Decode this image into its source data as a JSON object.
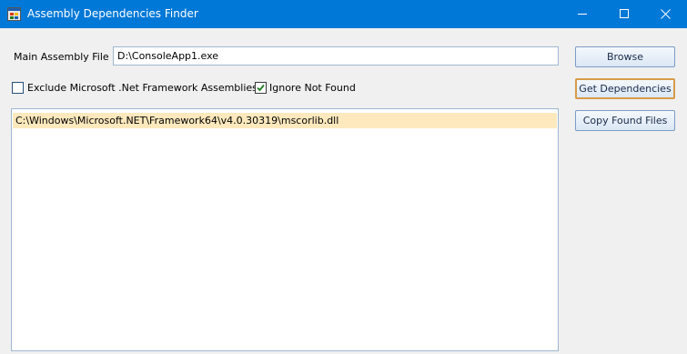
{
  "window": {
    "title": "Assembly Dependencies Finder",
    "accent_color": "#0078d7",
    "icon": "app-window-icon",
    "controls": [
      "minimize-icon",
      "maximize-icon",
      "close-icon"
    ]
  },
  "form": {
    "main_assembly_label": "Main Assembly File :",
    "main_assembly_value": "D:\\ConsoleApp1.exe",
    "exclude_ms_label": "Exclude Microsoft .Net Framework Assemblies",
    "exclude_ms_checked": false,
    "ignore_not_found_label": "Ignore Not Found",
    "ignore_not_found_checked": true
  },
  "buttons": {
    "browse": "Browse",
    "get_dependencies": "Get Dependencies",
    "copy_found_files": "Copy Found Files"
  },
  "results": {
    "items": [
      "C:\\Windows\\Microsoft.NET\\Framework64\\v4.0.30319\\mscorlib.dll"
    ],
    "selected_index": 0,
    "selected_color": "#fde9bd"
  }
}
